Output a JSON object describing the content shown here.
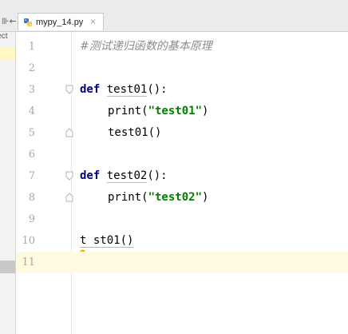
{
  "toolbar": {
    "left_button_label": "⊪←"
  },
  "tab": {
    "filename": "mypy_14.py",
    "close_glyph": "×",
    "icon": "python-file-icon"
  },
  "project_panel": {
    "label": "ject"
  },
  "editor": {
    "line_numbers": [
      "1",
      "2",
      "3",
      "4",
      "5",
      "6",
      "7",
      "8",
      "9",
      "10",
      "11"
    ],
    "current_line": 11,
    "lines": {
      "l1_comment": "#测试递归函数的基本原理",
      "l3_kw": "def",
      "l3_name": "test01",
      "l3_rest": "():",
      "l4_print": "print(",
      "l4_str": "\"test01\"",
      "l4_close": ")",
      "l5_call": "test01()",
      "l7_kw": "def",
      "l7_name": "test02",
      "l7_rest": "():",
      "l8_print": "print(",
      "l8_str": "\"test02\"",
      "l8_close": ")",
      "l10_pre": "t",
      "l10_post": "st01()"
    }
  },
  "colors": {
    "keyword": "#000080",
    "string": "#008000",
    "comment": "#8c8c8c",
    "current_line_bg": "#fffbe0"
  }
}
